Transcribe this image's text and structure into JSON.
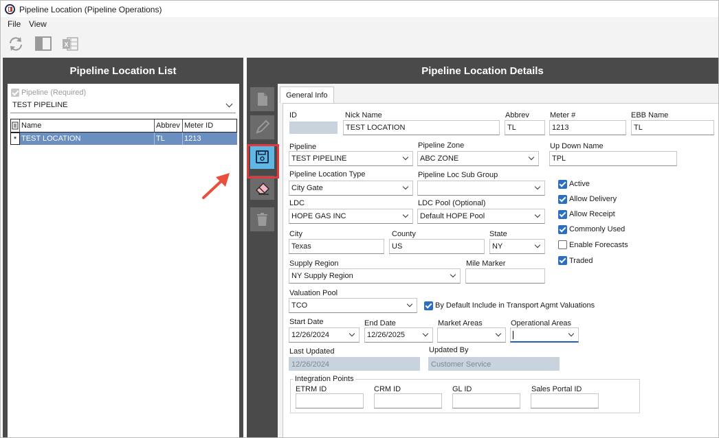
{
  "window": {
    "title": "Pipeline Location (Pipeline Operations)"
  },
  "menu": {
    "items": [
      "File",
      "View"
    ]
  },
  "toolbar": {
    "icons": [
      "refresh-icon",
      "panel-layout-icon",
      "excel-icon"
    ]
  },
  "left_panel": {
    "title": "Pipeline Location List",
    "pipeline_checkbox_label": "Pipeline (Required)",
    "pipeline_checked": true,
    "pipeline_value": "TEST PIPELINE",
    "grid": {
      "columns": [
        "Name",
        "Abbrev",
        "Meter ID"
      ],
      "rows": [
        {
          "marker": "*",
          "name": "TEST LOCATION",
          "abbrev": "TL",
          "meter_id": "1213"
        }
      ]
    }
  },
  "right_panel": {
    "title": "Pipeline Location Details",
    "side_buttons": [
      "new-document-icon",
      "edit-pencil-icon",
      "save-icon",
      "eraser-icon",
      "trash-icon"
    ],
    "tab": "General Info",
    "fields": {
      "id": {
        "label": "ID",
        "value": ""
      },
      "nick_name": {
        "label": "Nick Name",
        "value": "TEST LOCATION"
      },
      "abbrev": {
        "label": "Abbrev",
        "value": "TL"
      },
      "meter": {
        "label": "Meter #",
        "value": "1213"
      },
      "ebb_name": {
        "label": "EBB Name",
        "value": "TL"
      },
      "pipeline": {
        "label": "Pipeline",
        "value": "TEST PIPELINE"
      },
      "pipeline_zone": {
        "label": "Pipeline Zone",
        "value": "ABC ZONE"
      },
      "up_down_name": {
        "label": "Up Down Name",
        "value": "TPL"
      },
      "location_type": {
        "label": "Pipeline Location Type",
        "value": "City Gate"
      },
      "loc_sub_group": {
        "label": "Pipeline Loc Sub Group",
        "value": ""
      },
      "ldc": {
        "label": "LDC",
        "value": "HOPE GAS INC"
      },
      "ldc_pool": {
        "label": "LDC Pool (Optional)",
        "value": "Default HOPE Pool"
      },
      "city": {
        "label": "City",
        "value": "Texas"
      },
      "county": {
        "label": "County",
        "value": "US"
      },
      "state": {
        "label": "State",
        "value": "NY"
      },
      "supply_region": {
        "label": "Supply Region",
        "value": "NY Supply Region"
      },
      "mile_marker": {
        "label": "Mile Marker",
        "value": ""
      },
      "valuation_pool": {
        "label": "Valuation Pool",
        "value": "TCO"
      },
      "by_default": {
        "label": "By Default Include in Transport Agmt Valuations",
        "checked": true
      },
      "start_date": {
        "label": "Start Date",
        "value": "12/26/2024"
      },
      "end_date": {
        "label": "End Date",
        "value": "12/26/2025"
      },
      "market_areas": {
        "label": "Market Areas",
        "value": ""
      },
      "operational_areas": {
        "label": "Operational Areas",
        "value": ""
      },
      "last_updated": {
        "label": "Last Updated",
        "value": "12/26/2024"
      },
      "updated_by": {
        "label": "Updated By",
        "value": "Customer Service"
      }
    },
    "checkboxes": [
      {
        "label": "Active",
        "checked": true
      },
      {
        "label": "Allow Delivery",
        "checked": true
      },
      {
        "label": "Allow Receipt",
        "checked": true
      },
      {
        "label": "Commonly Used",
        "checked": true
      },
      {
        "label": "Enable Forecasts",
        "checked": false
      },
      {
        "label": "Traded",
        "checked": true
      }
    ],
    "integration_points": {
      "title": "Integration Points",
      "etrm_id": {
        "label": "ETRM ID",
        "value": ""
      },
      "crm_id": {
        "label": "CRM ID",
        "value": ""
      },
      "gl_id": {
        "label": "GL ID",
        "value": ""
      },
      "sales_portal_id": {
        "label": "Sales Portal ID",
        "value": ""
      }
    }
  },
  "colors": {
    "panel_dark": "#4a4a4a",
    "accent_blue": "#2b6fc4",
    "highlight_red": "#e23a3a",
    "save_button": "#5fb7e5",
    "selected_row": "#6a8fc0"
  }
}
